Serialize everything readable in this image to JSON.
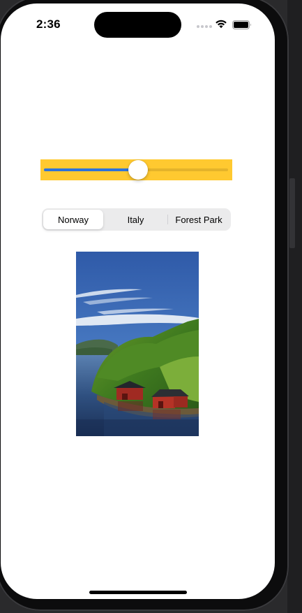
{
  "status_bar": {
    "time": "2:36"
  },
  "slider": {
    "value": 0.51,
    "background_color": "#ffc930",
    "fill_color": "#2f73d9"
  },
  "segmented_control": {
    "selected_index": 0,
    "segments": [
      {
        "label": "Norway"
      },
      {
        "label": "Italy"
      },
      {
        "label": "Forest Park"
      }
    ]
  },
  "image": {
    "subject": "norway-fjord-boathouses"
  },
  "icons": {
    "wifi": "wifi-icon",
    "battery": "battery-icon",
    "signal": "cellular-signal-icon"
  }
}
